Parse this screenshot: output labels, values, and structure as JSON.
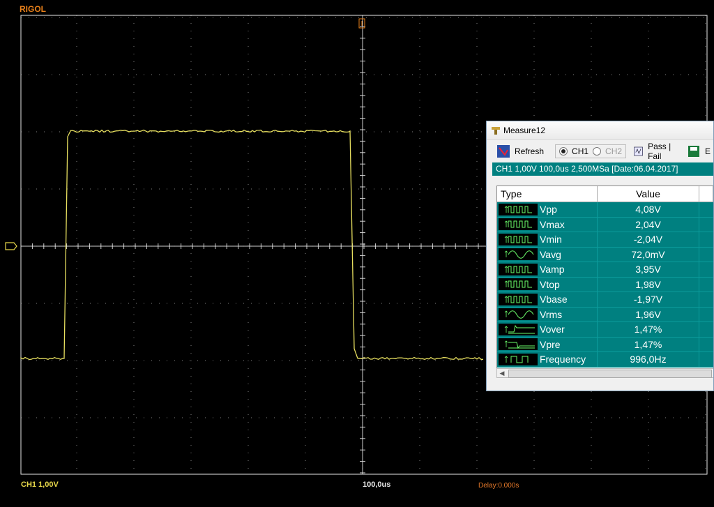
{
  "brand": "RIGOL",
  "colors": {
    "trace": "#e8e060",
    "grid": "#e8e8e8",
    "accent": "#e8801a",
    "table_bg": "#008080"
  },
  "status": {
    "channel_scale": "CH1 1,00V",
    "timebase": "100,0us",
    "delay": "Delay:0.000s"
  },
  "window": {
    "title": "Measure12",
    "refresh_label": "Refresh",
    "ch1_label": "CH1",
    "ch2_label": "CH2",
    "selected_channel": "CH1",
    "pass_fail_label": "Pass | Fail",
    "extra_tool_label": "E",
    "info": "CH1 1,00V 100,0us 2,500MSa [Date:06.04.2017]",
    "columns": {
      "type": "Type",
      "value": "Value"
    },
    "rows": [
      {
        "icon": "square-wave-icon",
        "name": "Vpp",
        "value": "4,08V"
      },
      {
        "icon": "square-wave-icon",
        "name": "Vmax",
        "value": "2,04V"
      },
      {
        "icon": "square-wave-icon",
        "name": "Vmin",
        "value": "-2,04V"
      },
      {
        "icon": "sine-wave-icon",
        "name": "Vavg",
        "value": "72,0mV"
      },
      {
        "icon": "square-wave-icon",
        "name": "Vamp",
        "value": "3,95V"
      },
      {
        "icon": "square-wave-icon",
        "name": "Vtop",
        "value": "1,98V"
      },
      {
        "icon": "square-wave-icon",
        "name": "Vbase",
        "value": "-1,97V"
      },
      {
        "icon": "sine-wave-icon",
        "name": "Vrms",
        "value": "1,96V"
      },
      {
        "icon": "overshoot-icon",
        "name": "Vover",
        "value": "1,47%"
      },
      {
        "icon": "preshoot-icon",
        "name": "Vpre",
        "value": "1,47%"
      },
      {
        "icon": "frequency-icon",
        "name": "Frequency",
        "value": "996,0Hz"
      }
    ]
  }
}
